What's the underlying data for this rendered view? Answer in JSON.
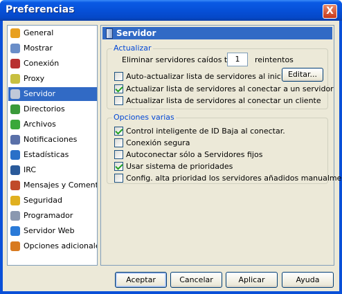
{
  "window": {
    "title": "Preferencias",
    "close_label": "X"
  },
  "sidebar": {
    "items": [
      {
        "label": "General",
        "icon": "gear-icon",
        "color": "#e8a020",
        "selected": false
      },
      {
        "label": "Mostrar",
        "icon": "monitor-icon",
        "color": "#6a8ec8",
        "selected": false
      },
      {
        "label": "Conexión",
        "icon": "plug-icon",
        "color": "#b83030",
        "selected": false
      },
      {
        "label": "Proxy",
        "icon": "proxy-icon",
        "color": "#c8c040",
        "selected": false
      },
      {
        "label": "Servidor",
        "icon": "server-icon",
        "color": "#c0c8d8",
        "selected": true
      },
      {
        "label": "Directorios",
        "icon": "folder-icon",
        "color": "#3a9a3a",
        "selected": false
      },
      {
        "label": "Archivos",
        "icon": "files-icon",
        "color": "#3aa83a",
        "selected": false
      },
      {
        "label": "Notificaciones",
        "icon": "notifications-icon",
        "color": "#5a70a8",
        "selected": false
      },
      {
        "label": "Estadísticas",
        "icon": "statistics-icon",
        "color": "#2a70c8",
        "selected": false
      },
      {
        "label": "IRC",
        "icon": "irc-icon",
        "color": "#2a5a9a",
        "selected": false
      },
      {
        "label": "Mensajes y Comentarios",
        "icon": "messages-icon",
        "color": "#c04a2a",
        "selected": false
      },
      {
        "label": "Seguridad",
        "icon": "security-icon",
        "color": "#e0b020",
        "selected": false
      },
      {
        "label": "Programador",
        "icon": "scheduler-icon",
        "color": "#8a98b0",
        "selected": false
      },
      {
        "label": "Servidor Web",
        "icon": "web-server-icon",
        "color": "#2a7ad8",
        "selected": false
      },
      {
        "label": "Opciones adicionales",
        "icon": "advanced-options-icon",
        "color": "#d87a20",
        "selected": false
      }
    ]
  },
  "panel": {
    "title": "Servidor",
    "actualizar": {
      "legend": "Actualizar",
      "retries_label": "Eliminar servidores caídos tras",
      "retries_value": "1",
      "retries_suffix": "reintentos",
      "edit_button": "Editar...",
      "options": [
        {
          "label": "Auto-actualizar lista de servidores al iniciar",
          "checked": false
        },
        {
          "label": "Actualizar lista de servidores al conectar a un servidor",
          "checked": true
        },
        {
          "label": "Actualizar lista de servidores al conectar un cliente",
          "checked": false
        }
      ]
    },
    "varias": {
      "legend": "Opciones varias",
      "options": [
        {
          "label": "Control inteligente de ID Baja al conectar.",
          "checked": true
        },
        {
          "label": "Conexión segura",
          "checked": false
        },
        {
          "label": "Autoconectar sólo a Servidores fijos",
          "checked": false
        },
        {
          "label": "Usar sistema de prioridades",
          "checked": true
        },
        {
          "label": "Config. alta prioridad los servidores añadidos manualmente",
          "checked": false
        }
      ]
    }
  },
  "footer": {
    "accept": "Aceptar",
    "cancel": "Cancelar",
    "apply": "Aplicar",
    "help": "Ayuda"
  }
}
